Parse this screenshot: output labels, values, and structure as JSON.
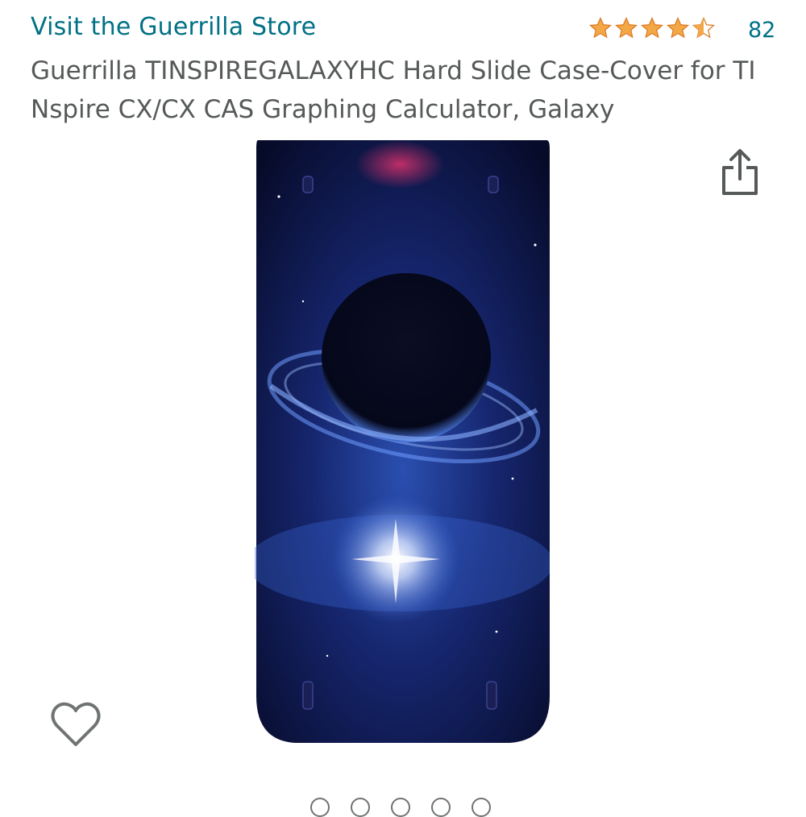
{
  "header": {
    "store_link": "Visit the Guerrilla Store",
    "rating": {
      "value": 4.5,
      "max": 5,
      "count": "82",
      "star_color": "#f3a847"
    }
  },
  "product": {
    "title": "Guerrilla TINSPIREGALAXYHC Hard Slide Case-Cover for TI Nspire CX/CX CAS Graphing Calculator, Galaxy",
    "image_alt": "Guerrilla Galaxy hard slide case-cover for TI Nspire calculator"
  },
  "actions": {
    "share_icon": "share-icon",
    "wishlist_icon": "heart-icon"
  },
  "carousel": {
    "image_count": 5,
    "active_index": 0
  },
  "colors": {
    "link": "#007185",
    "title": "#565959",
    "star": "#f3a847"
  }
}
